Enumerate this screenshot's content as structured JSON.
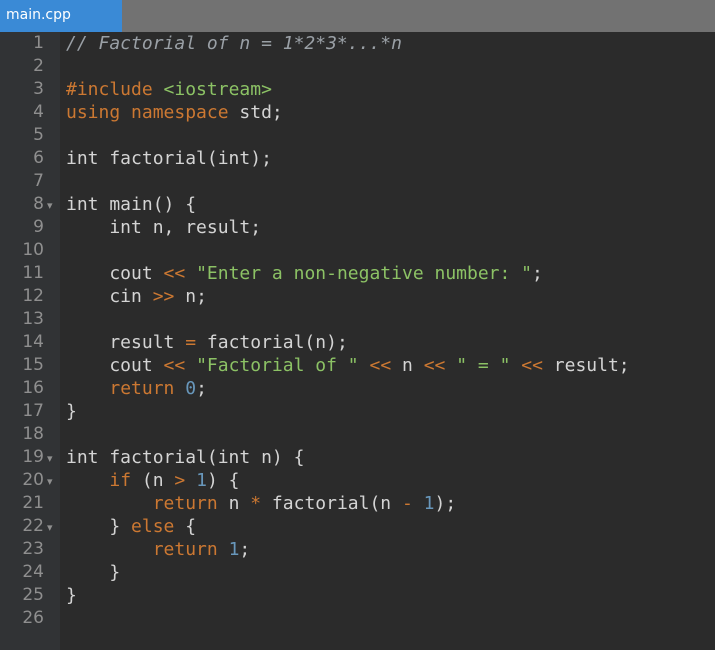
{
  "tab": {
    "title": "main.cpp"
  },
  "lines": [
    {
      "num": "1",
      "fold": false,
      "tokens": [
        {
          "t": "// Factorial of n = 1*2*3*...*n",
          "c": "cm"
        }
      ]
    },
    {
      "num": "2",
      "fold": false,
      "tokens": []
    },
    {
      "num": "3",
      "fold": false,
      "tokens": [
        {
          "t": "#include ",
          "c": "pp"
        },
        {
          "t": "<iostream>",
          "c": "inc"
        }
      ]
    },
    {
      "num": "4",
      "fold": false,
      "tokens": [
        {
          "t": "using",
          "c": "kw"
        },
        {
          "t": " ",
          "c": ""
        },
        {
          "t": "namespace",
          "c": "kw"
        },
        {
          "t": " std;",
          "c": ""
        }
      ]
    },
    {
      "num": "5",
      "fold": false,
      "tokens": []
    },
    {
      "num": "6",
      "fold": false,
      "tokens": [
        {
          "t": "int factorial(int);",
          "c": ""
        }
      ]
    },
    {
      "num": "7",
      "fold": false,
      "tokens": []
    },
    {
      "num": "8",
      "fold": true,
      "tokens": [
        {
          "t": "int main() {",
          "c": ""
        }
      ]
    },
    {
      "num": "9",
      "fold": false,
      "tokens": [
        {
          "t": "    int n, result;",
          "c": ""
        }
      ]
    },
    {
      "num": "10",
      "fold": false,
      "tokens": []
    },
    {
      "num": "11",
      "fold": false,
      "tokens": [
        {
          "t": "    cout ",
          "c": ""
        },
        {
          "t": "<<",
          "c": "op"
        },
        {
          "t": " ",
          "c": ""
        },
        {
          "t": "\"Enter a non-negative number: \"",
          "c": "str"
        },
        {
          "t": ";",
          "c": ""
        }
      ]
    },
    {
      "num": "12",
      "fold": false,
      "tokens": [
        {
          "t": "    cin ",
          "c": ""
        },
        {
          "t": ">>",
          "c": "op"
        },
        {
          "t": " n;",
          "c": ""
        }
      ]
    },
    {
      "num": "13",
      "fold": false,
      "tokens": []
    },
    {
      "num": "14",
      "fold": false,
      "tokens": [
        {
          "t": "    result ",
          "c": ""
        },
        {
          "t": "=",
          "c": "op"
        },
        {
          "t": " factorial(n);",
          "c": ""
        }
      ]
    },
    {
      "num": "15",
      "fold": false,
      "tokens": [
        {
          "t": "    cout ",
          "c": ""
        },
        {
          "t": "<<",
          "c": "op"
        },
        {
          "t": " ",
          "c": ""
        },
        {
          "t": "\"Factorial of \"",
          "c": "str"
        },
        {
          "t": " ",
          "c": ""
        },
        {
          "t": "<<",
          "c": "op"
        },
        {
          "t": " n ",
          "c": ""
        },
        {
          "t": "<<",
          "c": "op"
        },
        {
          "t": " ",
          "c": ""
        },
        {
          "t": "\" = \"",
          "c": "str"
        },
        {
          "t": " ",
          "c": ""
        },
        {
          "t": "<<",
          "c": "op"
        },
        {
          "t": " result;",
          "c": ""
        }
      ]
    },
    {
      "num": "16",
      "fold": false,
      "tokens": [
        {
          "t": "    ",
          "c": ""
        },
        {
          "t": "return",
          "c": "kw"
        },
        {
          "t": " ",
          "c": ""
        },
        {
          "t": "0",
          "c": "num"
        },
        {
          "t": ";",
          "c": ""
        }
      ]
    },
    {
      "num": "17",
      "fold": false,
      "tokens": [
        {
          "t": "}",
          "c": ""
        }
      ]
    },
    {
      "num": "18",
      "fold": false,
      "tokens": []
    },
    {
      "num": "19",
      "fold": true,
      "tokens": [
        {
          "t": "int factorial(int n) {",
          "c": ""
        }
      ]
    },
    {
      "num": "20",
      "fold": true,
      "tokens": [
        {
          "t": "    ",
          "c": ""
        },
        {
          "t": "if",
          "c": "kw"
        },
        {
          "t": " (n ",
          "c": ""
        },
        {
          "t": ">",
          "c": "op"
        },
        {
          "t": " ",
          "c": ""
        },
        {
          "t": "1",
          "c": "num"
        },
        {
          "t": ") {",
          "c": ""
        }
      ]
    },
    {
      "num": "21",
      "fold": false,
      "tokens": [
        {
          "t": "        ",
          "c": ""
        },
        {
          "t": "return",
          "c": "kw"
        },
        {
          "t": " n ",
          "c": ""
        },
        {
          "t": "*",
          "c": "op"
        },
        {
          "t": " factorial(n ",
          "c": ""
        },
        {
          "t": "-",
          "c": "op"
        },
        {
          "t": " ",
          "c": ""
        },
        {
          "t": "1",
          "c": "num"
        },
        {
          "t": ");",
          "c": ""
        }
      ]
    },
    {
      "num": "22",
      "fold": true,
      "tokens": [
        {
          "t": "    } ",
          "c": ""
        },
        {
          "t": "else",
          "c": "kw"
        },
        {
          "t": " {",
          "c": ""
        }
      ]
    },
    {
      "num": "23",
      "fold": false,
      "tokens": [
        {
          "t": "        ",
          "c": ""
        },
        {
          "t": "return",
          "c": "kw"
        },
        {
          "t": " ",
          "c": ""
        },
        {
          "t": "1",
          "c": "num"
        },
        {
          "t": ";",
          "c": ""
        }
      ]
    },
    {
      "num": "24",
      "fold": false,
      "tokens": [
        {
          "t": "    }",
          "c": ""
        }
      ]
    },
    {
      "num": "25",
      "fold": false,
      "tokens": [
        {
          "t": "}",
          "c": ""
        }
      ]
    },
    {
      "num": "26",
      "fold": false,
      "tokens": []
    }
  ],
  "icons": {
    "fold_marker": "chevron-down-icon"
  },
  "colors": {
    "tab_active": "#3a8ad6",
    "tabbar": "#727272",
    "editor_bg": "#2b2b2b",
    "gutter_bg": "#313335",
    "keyword": "#cc7832",
    "string": "#8cc265",
    "number": "#6897bb",
    "comment": "#9aa0a6",
    "default_text": "#d4d4d4",
    "line_number": "#8f8f8f"
  }
}
